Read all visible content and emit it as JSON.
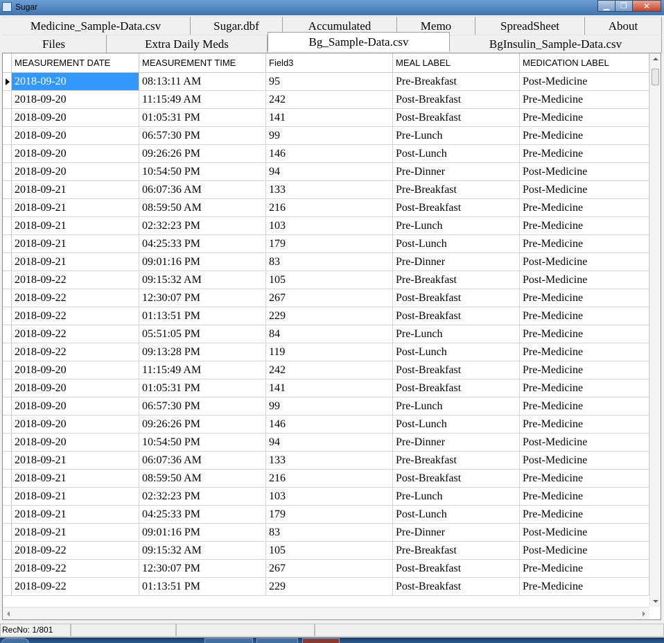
{
  "window": {
    "title": "Sugar"
  },
  "tabs": {
    "row1": [
      "Medicine_Sample-Data.csv",
      "Sugar.dbf",
      "Accumulated",
      "Memo",
      "SpreadSheet",
      "About"
    ],
    "row2": [
      "Files",
      "Extra Daily Meds",
      "Bg_Sample-Data.csv",
      "BgInsulin_Sample-Data.csv"
    ],
    "active": "Bg_Sample-Data.csv"
  },
  "grid": {
    "columns": [
      "MEASUREMENT DATE",
      "MEASUREMENT TIME",
      "Field3",
      "MEAL LABEL",
      "MEDICATION LABEL"
    ],
    "rows": [
      [
        "2018-09-20",
        "08:13:11 AM",
        "95",
        "Pre-Breakfast",
        "Post-Medicine"
      ],
      [
        "2018-09-20",
        "11:15:49 AM",
        "242",
        "Post-Breakfast",
        "Pre-Medicine"
      ],
      [
        "2018-09-20",
        "01:05:31 PM",
        "141",
        "Post-Breakfast",
        "Pre-Medicine"
      ],
      [
        "2018-09-20",
        "06:57:30 PM",
        "99",
        "Pre-Lunch",
        "Pre-Medicine"
      ],
      [
        "2018-09-20",
        "09:26:26 PM",
        "146",
        "Post-Lunch",
        "Pre-Medicine"
      ],
      [
        "2018-09-20",
        "10:54:50 PM",
        "94",
        "Pre-Dinner",
        "Post-Medicine"
      ],
      [
        "2018-09-21",
        "06:07:36 AM",
        "133",
        "Pre-Breakfast",
        "Post-Medicine"
      ],
      [
        "2018-09-21",
        "08:59:50 AM",
        "216",
        "Post-Breakfast",
        "Pre-Medicine"
      ],
      [
        "2018-09-21",
        "02:32:23 PM",
        "103",
        "Pre-Lunch",
        "Pre-Medicine"
      ],
      [
        "2018-09-21",
        "04:25:33 PM",
        "179",
        "Post-Lunch",
        "Pre-Medicine"
      ],
      [
        "2018-09-21",
        "09:01:16 PM",
        "83",
        "Pre-Dinner",
        "Post-Medicine"
      ],
      [
        "2018-09-22",
        "09:15:32 AM",
        "105",
        "Pre-Breakfast",
        "Post-Medicine"
      ],
      [
        "2018-09-22",
        "12:30:07 PM",
        "267",
        "Post-Breakfast",
        "Pre-Medicine"
      ],
      [
        "2018-09-22",
        "01:13:51 PM",
        "229",
        "Post-Breakfast",
        "Pre-Medicine"
      ],
      [
        "2018-09-22",
        "05:51:05 PM",
        "84",
        "Pre-Lunch",
        "Pre-Medicine"
      ],
      [
        "2018-09-22",
        "09:13:28 PM",
        "119",
        "Post-Lunch",
        "Pre-Medicine"
      ],
      [
        "2018-09-20",
        "11:15:49 AM",
        "242",
        "Post-Breakfast",
        "Pre-Medicine"
      ],
      [
        "2018-09-20",
        "01:05:31 PM",
        "141",
        "Post-Breakfast",
        "Pre-Medicine"
      ],
      [
        "2018-09-20",
        "06:57:30 PM",
        "99",
        "Pre-Lunch",
        "Pre-Medicine"
      ],
      [
        "2018-09-20",
        "09:26:26 PM",
        "146",
        "Post-Lunch",
        "Pre-Medicine"
      ],
      [
        "2018-09-20",
        "10:54:50 PM",
        "94",
        "Pre-Dinner",
        "Post-Medicine"
      ],
      [
        "2018-09-21",
        "06:07:36 AM",
        "133",
        "Pre-Breakfast",
        "Post-Medicine"
      ],
      [
        "2018-09-21",
        "08:59:50 AM",
        "216",
        "Post-Breakfast",
        "Pre-Medicine"
      ],
      [
        "2018-09-21",
        "02:32:23 PM",
        "103",
        "Pre-Lunch",
        "Pre-Medicine"
      ],
      [
        "2018-09-21",
        "04:25:33 PM",
        "179",
        "Post-Lunch",
        "Pre-Medicine"
      ],
      [
        "2018-09-21",
        "09:01:16 PM",
        "83",
        "Pre-Dinner",
        "Post-Medicine"
      ],
      [
        "2018-09-22",
        "09:15:32 AM",
        "105",
        "Pre-Breakfast",
        "Post-Medicine"
      ],
      [
        "2018-09-22",
        "12:30:07 PM",
        "267",
        "Post-Breakfast",
        "Pre-Medicine"
      ],
      [
        "2018-09-22",
        "01:13:51 PM",
        "229",
        "Post-Breakfast",
        "Pre-Medicine"
      ]
    ]
  },
  "status": {
    "recno": "RecNo: 1/801"
  },
  "colors": {
    "selection": "#3399ff",
    "titlebar": "#3f73b1",
    "close": "#c7432b"
  }
}
